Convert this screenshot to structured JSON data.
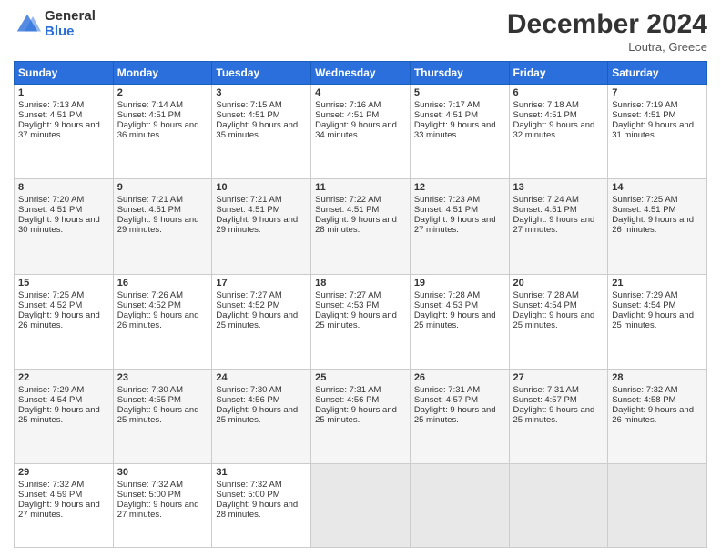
{
  "logo": {
    "general": "General",
    "blue": "Blue"
  },
  "header": {
    "month": "December 2024",
    "location": "Loutra, Greece"
  },
  "weekdays": [
    "Sunday",
    "Monday",
    "Tuesday",
    "Wednesday",
    "Thursday",
    "Friday",
    "Saturday"
  ],
  "weeks": [
    [
      {
        "day": "1",
        "sunrise": "7:13 AM",
        "sunset": "4:51 PM",
        "daylight": "9 hours and 37 minutes."
      },
      {
        "day": "2",
        "sunrise": "7:14 AM",
        "sunset": "4:51 PM",
        "daylight": "9 hours and 36 minutes."
      },
      {
        "day": "3",
        "sunrise": "7:15 AM",
        "sunset": "4:51 PM",
        "daylight": "9 hours and 35 minutes."
      },
      {
        "day": "4",
        "sunrise": "7:16 AM",
        "sunset": "4:51 PM",
        "daylight": "9 hours and 34 minutes."
      },
      {
        "day": "5",
        "sunrise": "7:17 AM",
        "sunset": "4:51 PM",
        "daylight": "9 hours and 33 minutes."
      },
      {
        "day": "6",
        "sunrise": "7:18 AM",
        "sunset": "4:51 PM",
        "daylight": "9 hours and 32 minutes."
      },
      {
        "day": "7",
        "sunrise": "7:19 AM",
        "sunset": "4:51 PM",
        "daylight": "9 hours and 31 minutes."
      }
    ],
    [
      {
        "day": "8",
        "sunrise": "7:20 AM",
        "sunset": "4:51 PM",
        "daylight": "9 hours and 30 minutes."
      },
      {
        "day": "9",
        "sunrise": "7:21 AM",
        "sunset": "4:51 PM",
        "daylight": "9 hours and 29 minutes."
      },
      {
        "day": "10",
        "sunrise": "7:21 AM",
        "sunset": "4:51 PM",
        "daylight": "9 hours and 29 minutes."
      },
      {
        "day": "11",
        "sunrise": "7:22 AM",
        "sunset": "4:51 PM",
        "daylight": "9 hours and 28 minutes."
      },
      {
        "day": "12",
        "sunrise": "7:23 AM",
        "sunset": "4:51 PM",
        "daylight": "9 hours and 27 minutes."
      },
      {
        "day": "13",
        "sunrise": "7:24 AM",
        "sunset": "4:51 PM",
        "daylight": "9 hours and 27 minutes."
      },
      {
        "day": "14",
        "sunrise": "7:25 AM",
        "sunset": "4:51 PM",
        "daylight": "9 hours and 26 minutes."
      }
    ],
    [
      {
        "day": "15",
        "sunrise": "7:25 AM",
        "sunset": "4:52 PM",
        "daylight": "9 hours and 26 minutes."
      },
      {
        "day": "16",
        "sunrise": "7:26 AM",
        "sunset": "4:52 PM",
        "daylight": "9 hours and 26 minutes."
      },
      {
        "day": "17",
        "sunrise": "7:27 AM",
        "sunset": "4:52 PM",
        "daylight": "9 hours and 25 minutes."
      },
      {
        "day": "18",
        "sunrise": "7:27 AM",
        "sunset": "4:53 PM",
        "daylight": "9 hours and 25 minutes."
      },
      {
        "day": "19",
        "sunrise": "7:28 AM",
        "sunset": "4:53 PM",
        "daylight": "9 hours and 25 minutes."
      },
      {
        "day": "20",
        "sunrise": "7:28 AM",
        "sunset": "4:54 PM",
        "daylight": "9 hours and 25 minutes."
      },
      {
        "day": "21",
        "sunrise": "7:29 AM",
        "sunset": "4:54 PM",
        "daylight": "9 hours and 25 minutes."
      }
    ],
    [
      {
        "day": "22",
        "sunrise": "7:29 AM",
        "sunset": "4:54 PM",
        "daylight": "9 hours and 25 minutes."
      },
      {
        "day": "23",
        "sunrise": "7:30 AM",
        "sunset": "4:55 PM",
        "daylight": "9 hours and 25 minutes."
      },
      {
        "day": "24",
        "sunrise": "7:30 AM",
        "sunset": "4:56 PM",
        "daylight": "9 hours and 25 minutes."
      },
      {
        "day": "25",
        "sunrise": "7:31 AM",
        "sunset": "4:56 PM",
        "daylight": "9 hours and 25 minutes."
      },
      {
        "day": "26",
        "sunrise": "7:31 AM",
        "sunset": "4:57 PM",
        "daylight": "9 hours and 25 minutes."
      },
      {
        "day": "27",
        "sunrise": "7:31 AM",
        "sunset": "4:57 PM",
        "daylight": "9 hours and 25 minutes."
      },
      {
        "day": "28",
        "sunrise": "7:32 AM",
        "sunset": "4:58 PM",
        "daylight": "9 hours and 26 minutes."
      }
    ],
    [
      {
        "day": "29",
        "sunrise": "7:32 AM",
        "sunset": "4:59 PM",
        "daylight": "9 hours and 27 minutes."
      },
      {
        "day": "30",
        "sunrise": "7:32 AM",
        "sunset": "5:00 PM",
        "daylight": "9 hours and 27 minutes."
      },
      {
        "day": "31",
        "sunrise": "7:32 AM",
        "sunset": "5:00 PM",
        "daylight": "9 hours and 28 minutes."
      },
      null,
      null,
      null,
      null
    ]
  ]
}
